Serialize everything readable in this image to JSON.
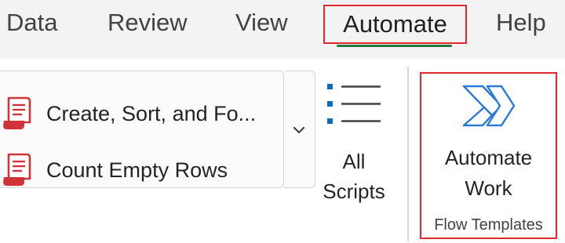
{
  "tabs": {
    "data": "Data",
    "review": "Review",
    "view": "View",
    "automate": "Automate",
    "help": "Help"
  },
  "scripts_gallery": {
    "items": [
      {
        "label": "Create, Sort, and Fo...",
        "icon": "script-document-icon"
      },
      {
        "label": "Count Empty Rows",
        "icon": "script-document-icon"
      }
    ],
    "expand_icon": "chevron-down-icon"
  },
  "all_scripts": {
    "label_line1": "All",
    "label_line2": "Scripts",
    "icon": "list-icon"
  },
  "flow_templates": {
    "button_line1": "Automate",
    "button_line2": "Work",
    "group_label": "Flow Templates",
    "icon": "power-automate-icon"
  },
  "colors": {
    "highlight_box": "#e0292f",
    "active_tab_underline": "#1f7a3c",
    "script_icon": "#d13438",
    "list_icon_bullet": "#0f6cbd",
    "power_automate_blue": "#2a7ad8"
  }
}
